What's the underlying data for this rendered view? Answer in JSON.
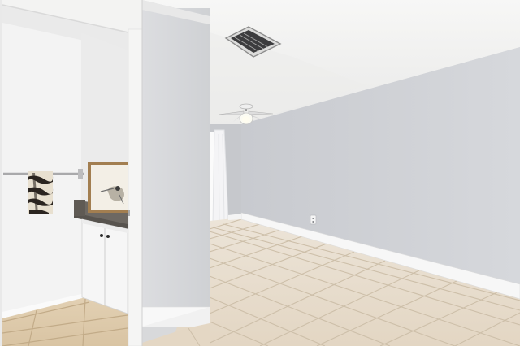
{
  "scene": {
    "description_hidden": "",
    "colors": {
      "ceiling": "#f4f4f3",
      "wall_right": "#d2d4d8",
      "wall_back": "#c9cbcf",
      "wall_center": "#d6d7da",
      "baseboard": "#f7f7f7",
      "floor_tile": "#e6dac9",
      "floor_grout": "#cfc2ae",
      "door_frame": "#f2f2f1",
      "bath_wall": "#f4f4f4",
      "cabinet": "#f6f6f6",
      "counter": "#6f6a63",
      "towel_dark": "#2a2420",
      "towel_light": "#e9e2d4",
      "frame_wood": "#a27e50",
      "curtain": "#f7f7f8"
    },
    "icons": [
      "ceiling-fan-icon",
      "air-vent-icon",
      "electrical-outlet-icon",
      "cabinet-knob-icon"
    ]
  }
}
